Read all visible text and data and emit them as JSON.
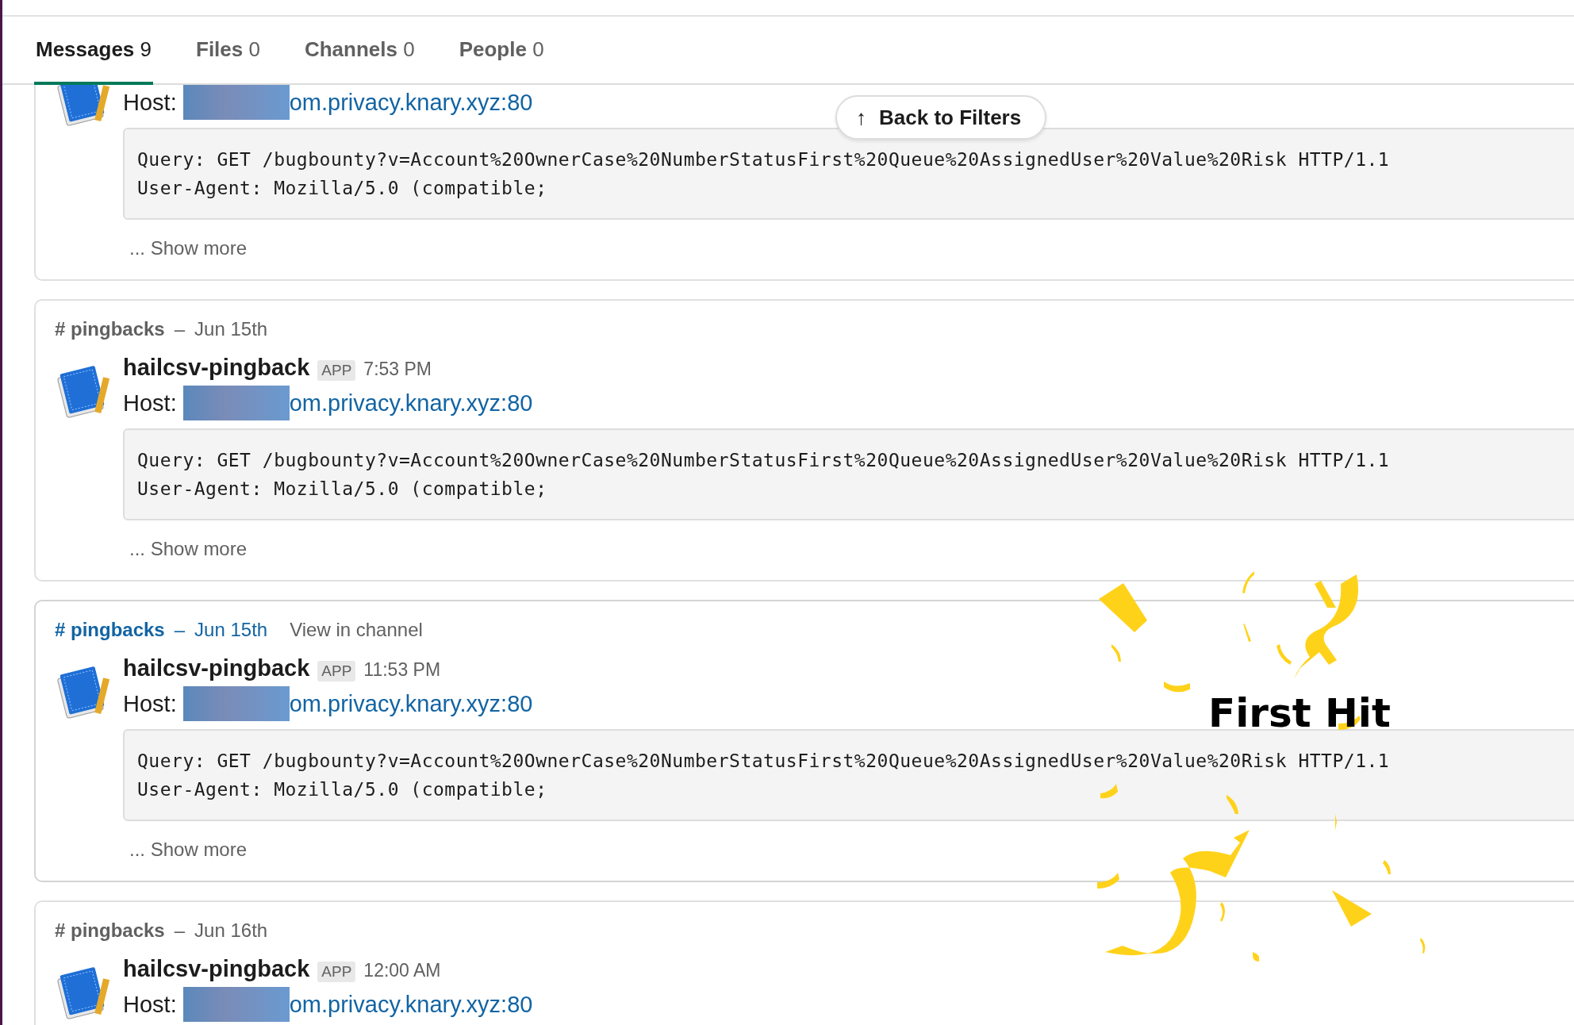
{
  "tabs": [
    {
      "label": "Messages",
      "count": "9",
      "selected": true
    },
    {
      "label": "Files",
      "count": "0",
      "selected": false
    },
    {
      "label": "Channels",
      "count": "0",
      "selected": false
    },
    {
      "label": "People",
      "count": "0",
      "selected": false
    }
  ],
  "back_button": {
    "label": "Back to Filters",
    "icon": "↑"
  },
  "messages": [
    {
      "hovered": false,
      "host_label": "Host:",
      "host_link": "om.privacy.knary.xyz:80",
      "code_lines": [
        "Query: GET /bugbounty?v=Account%20OwnerCase%20NumberStatusFirst%20Queue%20AssignedUser%20Value%20Risk HTTP/1.1",
        "User-Agent: Mozilla/5.0 (compatible;"
      ],
      "show_more": "... Show more"
    },
    {
      "hovered": false,
      "channel": "# pingbacks",
      "separator": "–",
      "date": "Jun 15th",
      "sender": "hailcsv-pingback",
      "badge": "APP",
      "time": "7:53 PM",
      "host_label": "Host:",
      "host_link": "om.privacy.knary.xyz:80",
      "code_lines": [
        "Query: GET /bugbounty?v=Account%20OwnerCase%20NumberStatusFirst%20Queue%20AssignedUser%20Value%20Risk HTTP/1.1",
        "User-Agent: Mozilla/5.0 (compatible;"
      ],
      "show_more": "... Show more"
    },
    {
      "hovered": true,
      "channel": "# pingbacks",
      "separator": "–",
      "date": "Jun 15th",
      "view_in_channel": "View in channel",
      "sender": "hailcsv-pingback",
      "badge": "APP",
      "time": "11:53 PM",
      "host_label": "Host:",
      "host_link": "om.privacy.knary.xyz:80",
      "code_lines": [
        "Query: GET /bugbounty?v=Account%20OwnerCase%20NumberStatusFirst%20Queue%20AssignedUser%20Value%20Risk HTTP/1.1",
        "User-Agent: Mozilla/5.0 (compatible;"
      ],
      "show_more": "... Show more"
    },
    {
      "hovered": false,
      "channel": "# pingbacks",
      "separator": "–",
      "date": "Jun 16th",
      "sender": "hailcsv-pingback",
      "badge": "APP",
      "time": "12:00 AM",
      "host_label": "Host:",
      "host_link": "om.privacy.knary.xyz:80"
    }
  ],
  "overlay": {
    "title": "First Hit"
  }
}
